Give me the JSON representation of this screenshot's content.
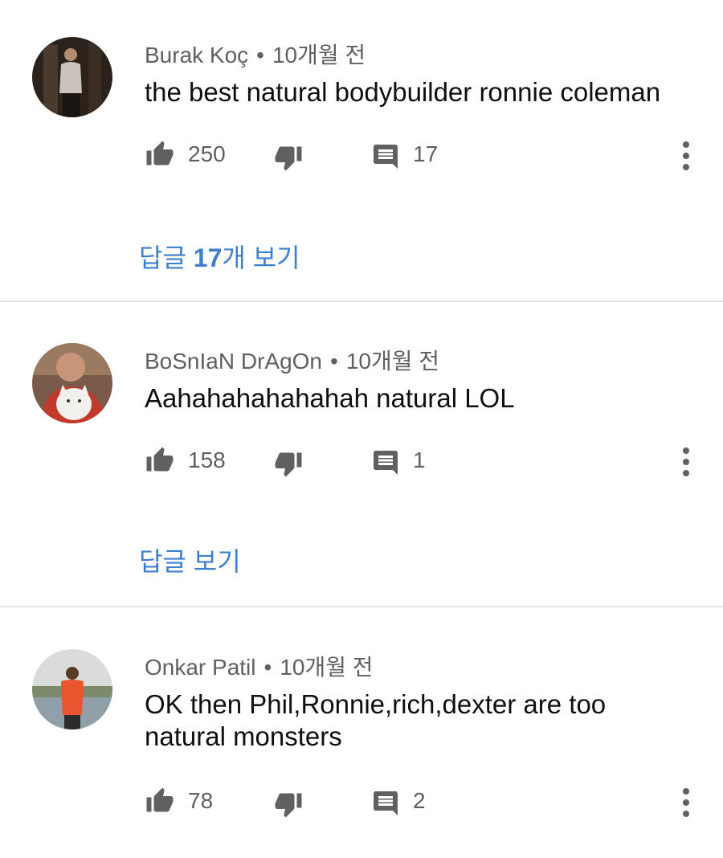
{
  "comments": [
    {
      "author": "Burak Koç",
      "time": "10개월 전",
      "text": "the best natural bodybuilder ronnie coleman",
      "likes": "250",
      "replies_count": "17",
      "view_replies": {
        "prefix": "답글 ",
        "count": "17",
        "suffix": "개 보기"
      }
    },
    {
      "author": "BoSnIaN DrAgOn",
      "time": "10개월 전",
      "text": "Aahahahahahahah natural LOL",
      "likes": "158",
      "replies_count": "1",
      "view_replies": {
        "label": "답글 보기"
      }
    },
    {
      "author": "Onkar Patil",
      "time": "10개월 전",
      "text": "OK then Phil,Ronnie,rich,dexter are too natural monsters",
      "likes": "78",
      "replies_count": "2"
    }
  ],
  "separator": "•",
  "icons": {
    "like": "thumbs-up-icon",
    "dislike": "thumbs-down-icon",
    "reply": "comment-icon",
    "more": "more-vertical-icon"
  },
  "colors": {
    "link": "#3e80cf",
    "meta": "#606060",
    "icon": "#606060",
    "divider": "#e2e2e2"
  }
}
